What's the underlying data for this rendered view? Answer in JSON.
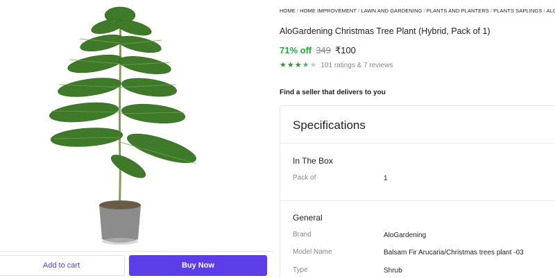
{
  "product": {
    "breadcrumb": [
      "HOME",
      "HOME IMPROVEMENT",
      "LAWN AND GARDENING",
      "PLANTS AND PLANTERS",
      "PLANTS SAPLINGS",
      "ALOG"
    ],
    "title": "AloGardening Christmas Tree Plant (Hybrid, Pack of 1)",
    "discount": "71% off",
    "mrp": "349",
    "price": "₹100",
    "rating_value": 3.5,
    "ratings_text": "101 ratings & 7 reviews",
    "image_icon": "potted-tree-image",
    "star_color": "#388e3c"
  },
  "seller": {
    "prompt": "Find a seller that delivers to you"
  },
  "actions": {
    "add_to_cart": "Add to cart",
    "buy_now": "Buy Now",
    "accent": "#5b3ee8"
  },
  "specifications": {
    "title": "Specifications",
    "sections": [
      {
        "title": "In The Box",
        "rows": [
          {
            "key": "Pack of",
            "value": "1"
          }
        ]
      },
      {
        "title": "General",
        "rows": [
          {
            "key": "Brand",
            "value": "AloGardening"
          },
          {
            "key": "Model Name",
            "value": "Balsam Fir Arucaria/Christmas trees plant -03"
          },
          {
            "key": "Type",
            "value": "Shrub"
          }
        ]
      }
    ]
  }
}
